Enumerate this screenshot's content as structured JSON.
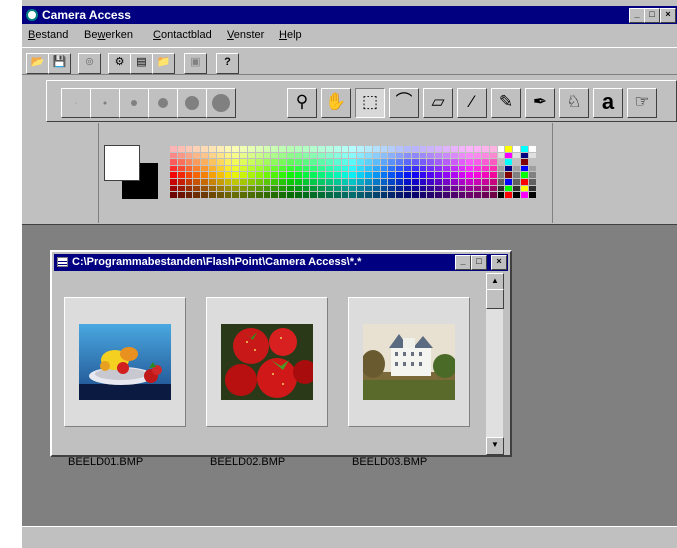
{
  "window": {
    "title": "Camera Access",
    "controls": [
      "_",
      "□",
      "×"
    ]
  },
  "menu": [
    {
      "label": "Bestand",
      "underline": "B",
      "rest": "estand"
    },
    {
      "label": "Bewerken",
      "pre": "Be",
      "underline": "w",
      "rest": "erken"
    },
    {
      "label": "Contactblad",
      "underline": "C",
      "rest": "ontactblad"
    },
    {
      "label": "Venster",
      "underline": "V",
      "rest": "enster"
    },
    {
      "label": "Help",
      "underline": "H",
      "rest": "elp"
    }
  ],
  "toolbar": {
    "buttons": [
      {
        "name": "open-icon",
        "glyph": "📂"
      },
      {
        "name": "save-icon",
        "glyph": "💾"
      },
      {
        "name": "scan-icon",
        "glyph": "⊚"
      },
      {
        "name": "camera-icon",
        "glyph": "⚙"
      },
      {
        "name": "contactsheet-icon",
        "glyph": "▤"
      },
      {
        "name": "folder-icon",
        "glyph": "📁"
      },
      {
        "name": "print-icon",
        "glyph": "▣"
      },
      {
        "name": "help-icon",
        "glyph": "?"
      }
    ]
  },
  "brush_sizes": [
    1,
    3,
    6,
    10,
    14,
    18
  ],
  "tools": [
    {
      "name": "zoom-tool-icon",
      "glyph": "⚲"
    },
    {
      "name": "hand-tool-icon",
      "glyph": "✋"
    },
    {
      "name": "rect-select-tool-icon",
      "glyph": "⬚"
    },
    {
      "name": "lasso-tool-icon",
      "glyph": "⌒"
    },
    {
      "name": "eraser-tool-icon",
      "glyph": "▱"
    },
    {
      "name": "brush-tool-icon",
      "glyph": "⁄"
    },
    {
      "name": "pencil-tool-icon",
      "glyph": "✎"
    },
    {
      "name": "eyedropper-tool-icon",
      "glyph": "✒"
    },
    {
      "name": "fill-tool-icon",
      "glyph": "♘"
    },
    {
      "name": "text-tool-icon",
      "glyph": "a"
    },
    {
      "name": "smudge-tool-icon",
      "glyph": "☞"
    }
  ],
  "colors": {
    "titlebar": "#000080",
    "foreground": "#ffffff",
    "background": "#000000",
    "workspace": "#808080"
  },
  "child_window": {
    "title": "C:\\Programmabestanden\\FlashPoint\\Camera Access\\*.*",
    "controls": [
      "_",
      "□",
      "×"
    ],
    "thumbnails": [
      {
        "label": "BEELD01.BMP"
      },
      {
        "label": "BEELD02.BMP"
      },
      {
        "label": "BEELD03.BMP"
      }
    ],
    "scroll": {
      "up": "▲",
      "down": "▼"
    }
  }
}
